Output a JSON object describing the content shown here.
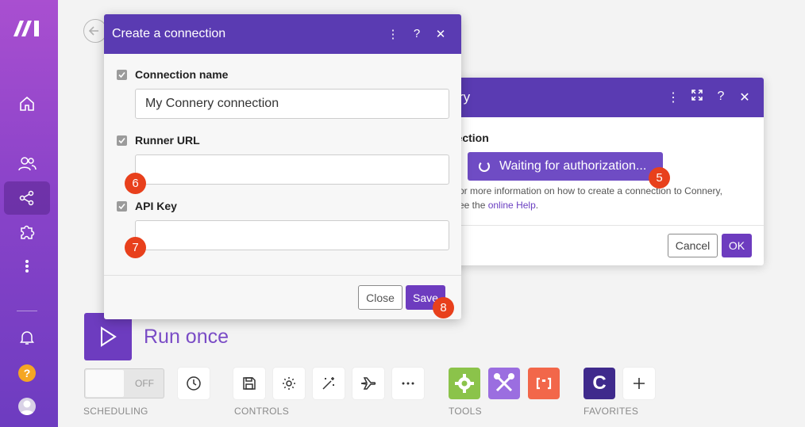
{
  "sidebar": {
    "logo": "make-logo-icon",
    "items": [
      {
        "icon": "home-icon"
      },
      {
        "icon": "users-icon"
      },
      {
        "icon": "share-icon",
        "active": true
      },
      {
        "icon": "puzzle-icon"
      },
      {
        "icon": "more-vertical-icon"
      }
    ],
    "bottom": [
      {
        "icon": "bell-icon"
      },
      {
        "icon": "help-icon",
        "label": "?"
      },
      {
        "icon": "avatar-icon"
      }
    ]
  },
  "run": {
    "label": "Run once"
  },
  "toolbar": {
    "toggle_off_label": "OFF",
    "groups": {
      "scheduling": "SCHEDULING",
      "controls": "CONTROLS",
      "tools": "TOOLS",
      "favorites": "FAVORITES"
    },
    "favorite_app_letter": "C"
  },
  "dialog_back": {
    "title_partial": "ry",
    "field_label_partial": "nection",
    "waiting_label": "Waiting for authorization...",
    "info_line1": "or more information on how to create a connection to Connery,",
    "info_line2_prefix": "ee the ",
    "info_link": "online Help",
    "info_line2_suffix": ".",
    "cancel_label": "Cancel",
    "ok_label": "OK"
  },
  "dialog_front": {
    "title": "Create a connection",
    "fields": [
      {
        "label": "Connection name",
        "value": "My Connery connection",
        "placeholder": ""
      },
      {
        "label": "Runner URL",
        "value": "",
        "placeholder": ""
      },
      {
        "label": "API Key",
        "value": "",
        "placeholder": ""
      }
    ],
    "close_label": "Close",
    "save_label": "Save"
  },
  "markers": [
    "5",
    "6",
    "7",
    "8"
  ],
  "colors": {
    "brand": "#6d3cbf",
    "header": "#5a3bb2",
    "marker": "#e8401c"
  }
}
